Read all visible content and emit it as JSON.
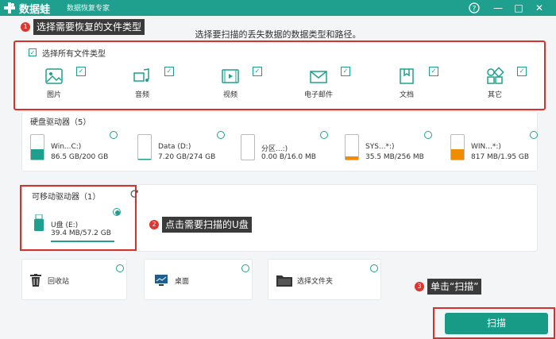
{
  "app": {
    "name": "数据蛙",
    "subtitle": "数据恢复专家"
  },
  "window_controls": {
    "help": "?",
    "minimize": "—",
    "maximize": "□",
    "close": "✕"
  },
  "instruction": "选择要扫描的丢失数据的数据类型和路径。",
  "callouts": [
    {
      "number": "1",
      "text": "选择需要恢复的文件类型"
    },
    {
      "number": "2",
      "text": "点击需要扫描的U盘"
    },
    {
      "number": "3",
      "text": "单击“扫描”"
    }
  ],
  "file_types": {
    "select_all_label": "选择所有文件类型",
    "select_all_checked": true,
    "items": [
      {
        "label": "图片",
        "icon": "image-icon",
        "checked": true
      },
      {
        "label": "音频",
        "icon": "music-icon",
        "checked": true
      },
      {
        "label": "视频",
        "icon": "video-icon",
        "checked": true
      },
      {
        "label": "电子邮件",
        "icon": "email-icon",
        "checked": true
      },
      {
        "label": "文档",
        "icon": "document-icon",
        "checked": true
      },
      {
        "label": "其它",
        "icon": "other-icon",
        "checked": true
      }
    ]
  },
  "hard_drives": {
    "title": "硬盘驱动器（5）",
    "items": [
      {
        "name": "Win...C:)",
        "size": "86.5 GB/200 GB",
        "fill": 0.43,
        "color": "#1fa08f"
      },
      {
        "name": "Data (D:)",
        "size": "7.20 GB/274 GB",
        "fill": 0.03,
        "color": "#1fa08f"
      },
      {
        "name": "分区...:)",
        "size": "0.00  B/16.0 MB",
        "fill": 0.0,
        "color": "#1fa08f"
      },
      {
        "name": "SYS...*:)",
        "size": "35.5 MB/256 MB",
        "fill": 0.14,
        "color": "#f08c00"
      },
      {
        "name": "WIN...*:)",
        "size": "817 MB/1.95 GB",
        "fill": 0.42,
        "color": "#f08c00"
      }
    ]
  },
  "removable": {
    "title": "可移动驱动器（1）",
    "item": {
      "name": "U盘 (E:)",
      "size": "39.4 MB/57.2 GB",
      "selected": true
    }
  },
  "locations": [
    {
      "label": "回收站",
      "icon": "recycle-bin-icon"
    },
    {
      "label": "桌面",
      "icon": "desktop-icon"
    },
    {
      "label": "选择文件夹",
      "icon": "folder-icon"
    }
  ],
  "scan_button": "扫描",
  "colors": {
    "accent": "#1fa08f",
    "highlight": "#d9302c",
    "warning": "#f08c00"
  }
}
